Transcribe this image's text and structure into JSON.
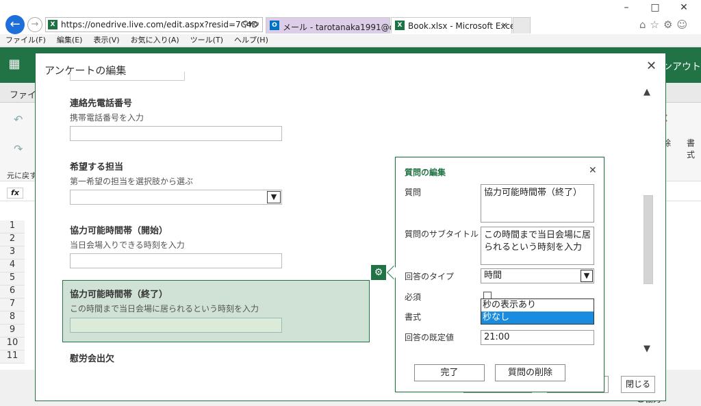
{
  "browser": {
    "url": "https://onedrive.live.com/edit.aspx?resid=7C4D",
    "tabs": [
      {
        "label": "メール - tarotanaka1991@outloo...",
        "icon": "outlook-icon"
      },
      {
        "label": "Book.xlsx - Microsoft Excel ...",
        "icon": "excel-icon"
      }
    ],
    "menu": [
      "ファイル(F)",
      "編集(E)",
      "表示(V)",
      "お気に入り(A)",
      "ツール(T)",
      "ヘルプ(H)"
    ]
  },
  "excel": {
    "top_right": "ンアウト",
    "ribbon_file": "ファイ",
    "undo_label": "元に戻す",
    "fx": "fx",
    "ribbon_right_a": "除",
    "ribbon_right_b": "書式",
    "rows": [
      "1",
      "2",
      "3",
      "4",
      "5",
      "6",
      "7",
      "8",
      "9",
      "10",
      "11"
    ],
    "status_right": "ご協力"
  },
  "dialog": {
    "title": "アンケートの編集",
    "questions": [
      {
        "title": "連絡先電話番号",
        "subtitle": "携帯電話番号を入力"
      },
      {
        "title": "希望する担当",
        "subtitle": "第一希望の担当を選択肢から選ぶ"
      },
      {
        "title": "協力可能時間帯（開始）",
        "subtitle": "当日会場入りできる時刻を入力"
      },
      {
        "title": "協力可能時間帯（終了）",
        "subtitle": "この時間まで当日会場に居られるという時刻を入力"
      },
      {
        "title": "慰労会出欠",
        "subtitle": ""
      }
    ],
    "close_button": "閉じる"
  },
  "edit_panel": {
    "title": "質問の編集",
    "question_label": "質問",
    "question_value": "協力可能時間帯（終了）",
    "subtitle_label": "質問のサブタイトル",
    "subtitle_value": "この時間まで当日会場に居られるという時刻を入力",
    "answer_type_label": "回答のタイプ",
    "answer_type_value": "時間",
    "required_label": "必須",
    "required_checked": false,
    "format_label": "書式",
    "format_options": [
      "秒の表示あり",
      "秒なし"
    ],
    "format_selected": "秒なし",
    "default_label": "回答の既定値",
    "default_value": "21:00",
    "done_button": "完了",
    "delete_button": "質問の削除"
  },
  "colors": {
    "excel_green": "#217346",
    "selection_blue": "#1a8ce0",
    "browser_blue": "#1e6fd9"
  }
}
